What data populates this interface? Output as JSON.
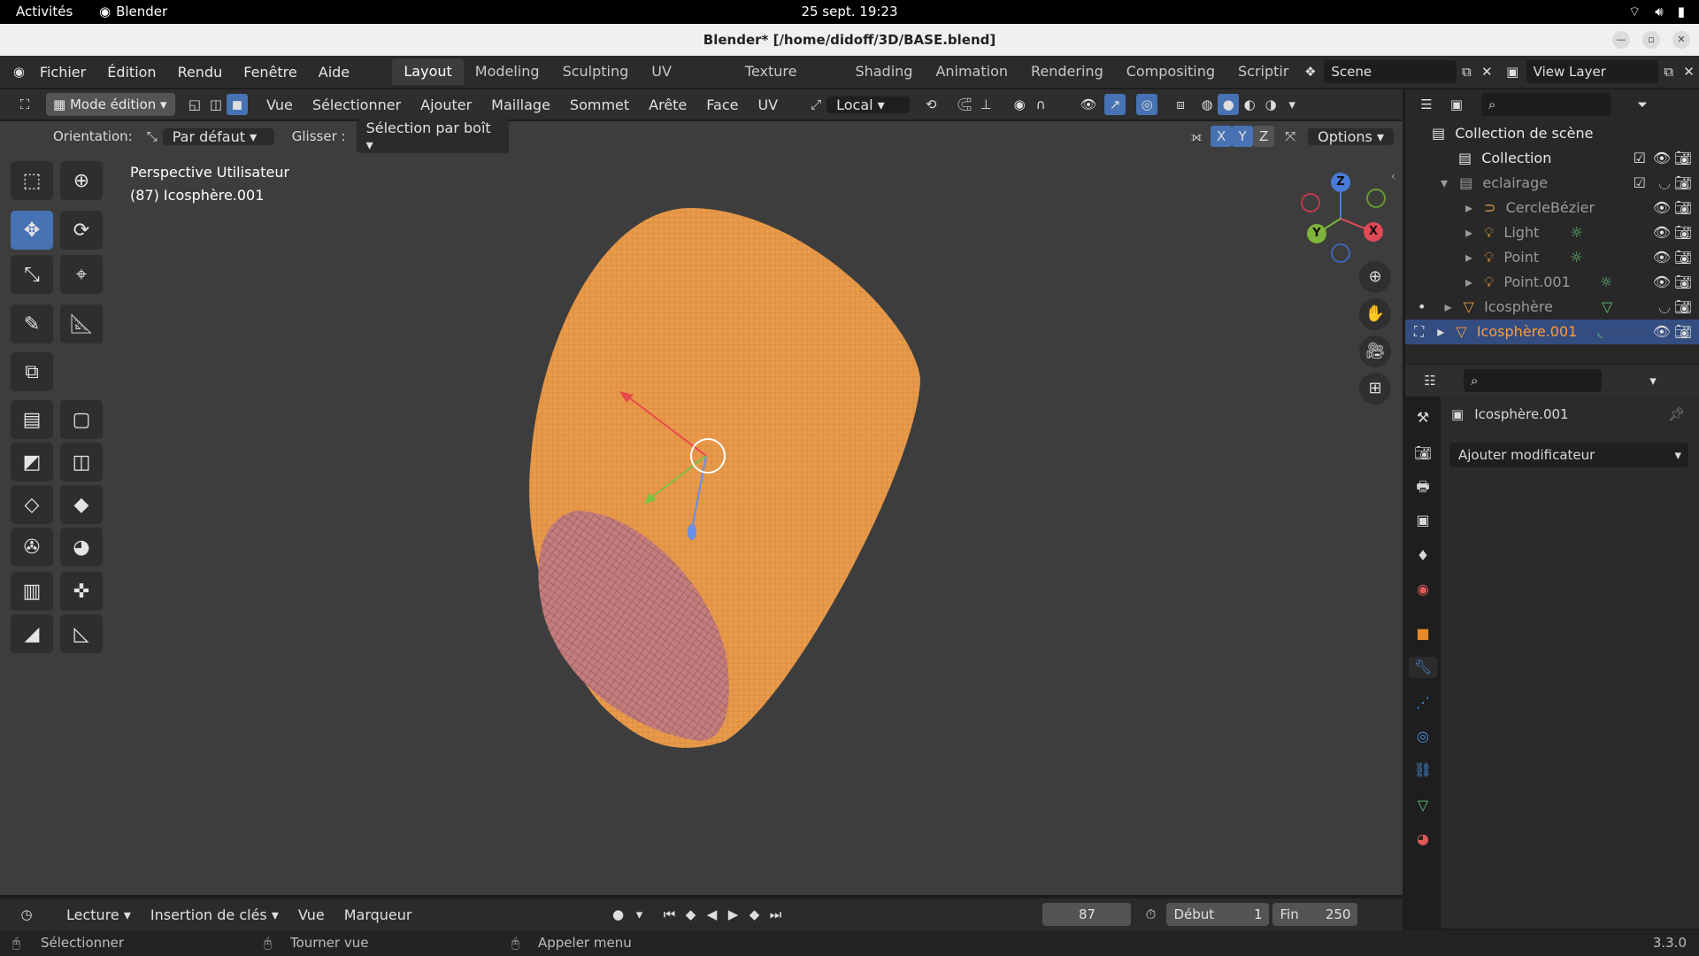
{
  "gnome": {
    "activities": "Activités",
    "app_name": "Blender",
    "clock": "25 sept.  19:23"
  },
  "window": {
    "title": "Blender* [/home/didoff/3D/BASE.blend]"
  },
  "menubar": {
    "menus": [
      "Fichier",
      "Édition",
      "Rendu",
      "Fenêtre",
      "Aide"
    ],
    "workspaces": [
      "Layout",
      "Modeling",
      "Sculpting",
      "UV Editing",
      "Texture Paint",
      "Shading",
      "Animation",
      "Rendering",
      "Compositing",
      "Scriptir"
    ],
    "active_workspace": "Layout",
    "scene": "Scene",
    "view_layer": "View Layer"
  },
  "viewport_header": {
    "mode": "Mode édition",
    "menus": [
      "Vue",
      "Sélectionner",
      "Ajouter",
      "Maillage",
      "Sommet",
      "Arête",
      "Face",
      "UV"
    ],
    "transform_orientation": "Local"
  },
  "tool_header": {
    "orientation_label": "Orientation:",
    "orientation_value": "Par défaut",
    "drag_label": "Glisser :",
    "drag_value": "Sélection par boît",
    "axis_x": "X",
    "axis_y": "Y",
    "axis_z": "Z",
    "options": "Options"
  },
  "viewport": {
    "view_name": "Perspective Utilisateur",
    "object_info": "(87) Icosphère.001",
    "gizmo": {
      "x": "X",
      "y": "Y",
      "z": "Z"
    },
    "mesh_color": "#e89a4a",
    "inner_color": "#c27a7a"
  },
  "outliner": {
    "root": "Collection de scène",
    "rows": [
      {
        "label": "Collection"
      },
      {
        "label": "eclairage"
      },
      {
        "label": "CercleBézier"
      },
      {
        "label": "Light"
      },
      {
        "label": "Point"
      },
      {
        "label": "Point.001"
      },
      {
        "label": "Icosphère"
      },
      {
        "label": "Icosphère.001"
      }
    ]
  },
  "properties": {
    "object_name": "Icosphère.001",
    "add_modifier": "Ajouter modificateur"
  },
  "timeline": {
    "playback": "Lecture",
    "keying": "Insertion de clés",
    "view": "Vue",
    "markers": "Marqueur",
    "current_frame": "87",
    "start_label": "Début",
    "start_value": "1",
    "end_label": "Fin",
    "end_value": "250"
  },
  "statusbar": {
    "select": "Sélectionner",
    "rotate": "Tourner vue",
    "menu": "Appeler menu",
    "version": "3.3.0"
  }
}
